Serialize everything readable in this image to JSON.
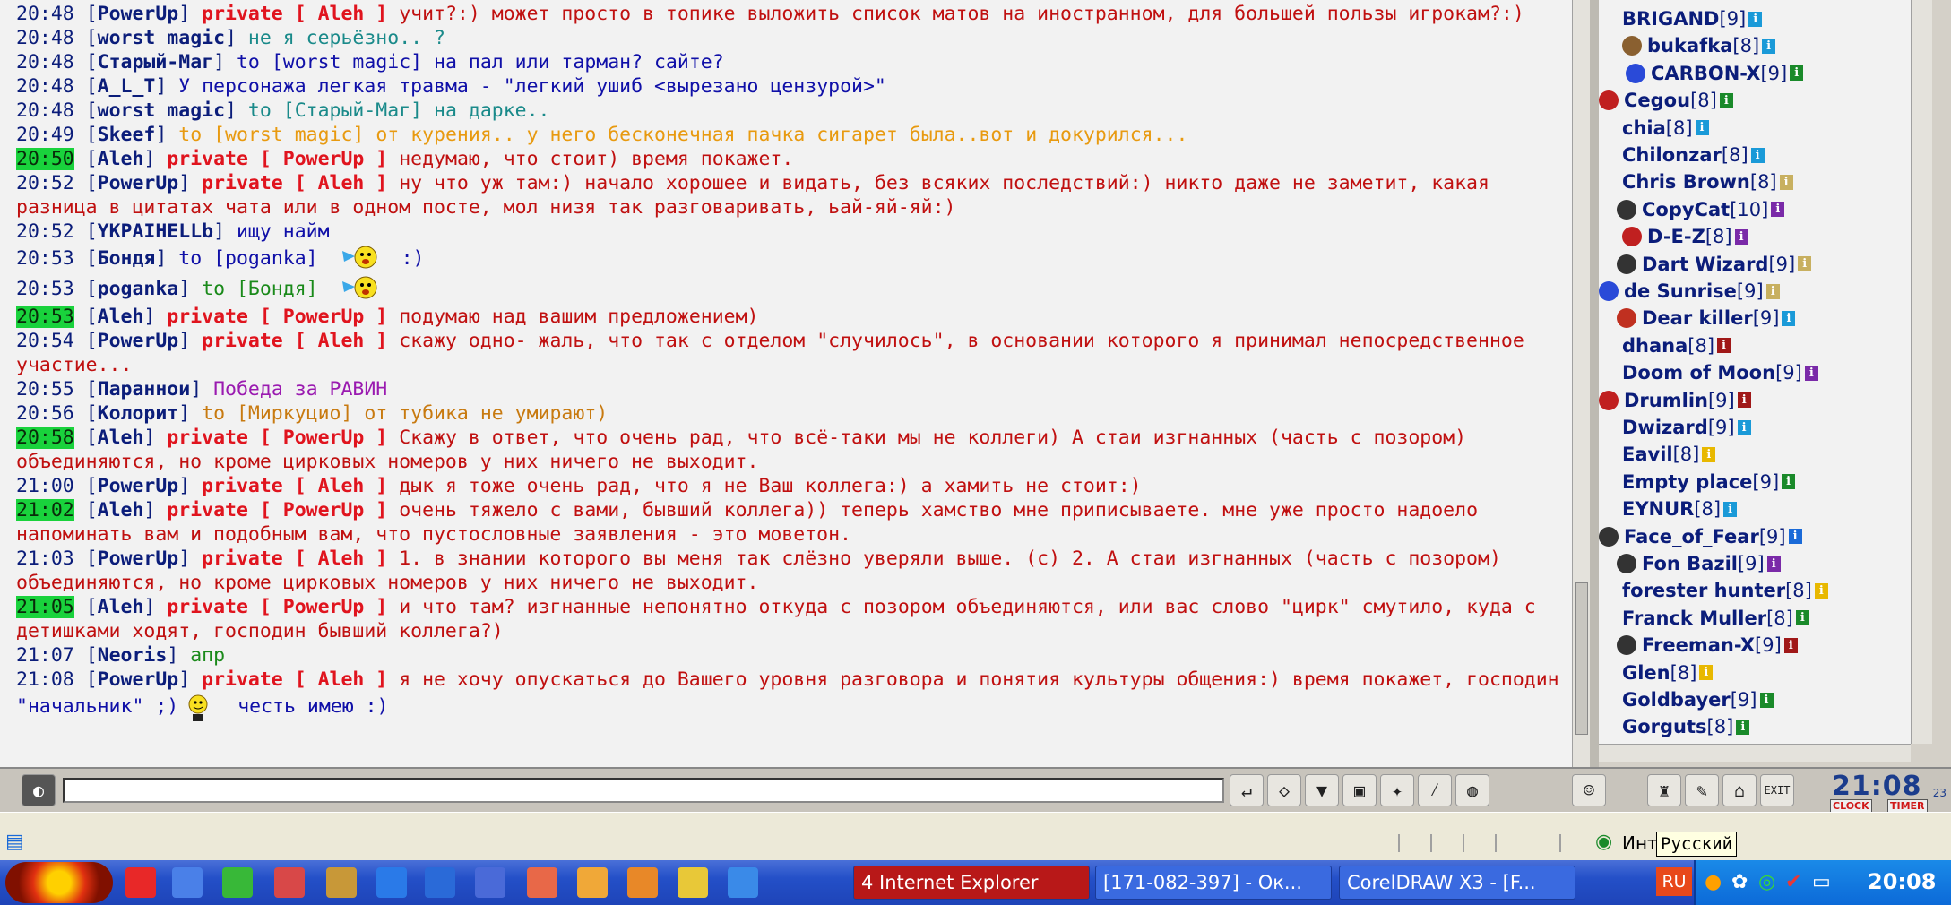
{
  "chat": {
    "lines": [
      {
        "time": "20:48",
        "nick": "PowerUp",
        "private": "private [ Aleh ]",
        "msg": "учит?:) может просто в топике выложить список матов на иностранном, для большей пользы игрокам?:)"
      },
      {
        "time": "20:48",
        "nick": "worst magic",
        "msg": "не я серьёзно.. ?"
      },
      {
        "time": "20:48",
        "nick": "Старый-Маг",
        "to": "to [worst magic]",
        "msg": "на пал или тарман? сайте?"
      },
      {
        "time": "20:48",
        "nick": "A_L_T",
        "msg": "У персонажа легкая травма - \"легкий ушиб <вырезано цензурой>\""
      },
      {
        "time": "20:48",
        "nick": "worst magic",
        "to": "to [Старый-Маг]",
        "msg": "на дарке.."
      },
      {
        "time": "20:49",
        "nick": "Skeef",
        "to": "to [worst magic]",
        "msg": "от курения.. у него бесконечная пачка сигарет была..вот и докурился..."
      },
      {
        "time": "20:50",
        "nick": "Aleh",
        "private": "private [ PowerUp ]",
        "msg": "недумаю, что стоит) время покажет."
      },
      {
        "time": "20:52",
        "nick": "PowerUp",
        "private": "private [ Aleh ]",
        "msg": "ну что уж там:) начало хорошее и видать, без всяких последствий:) никто даже не заметит, какая разница в цитатах чата или в одном посте, мол низя так разговаривать, ьай-яй-яй:)"
      },
      {
        "time": "20:52",
        "nick": "YKPAIHELLb",
        "msg": "ищу найм"
      },
      {
        "time": "20:53",
        "nick": "Бондя",
        "to": "to [poganka]",
        "msg": ":)"
      },
      {
        "time": "20:53",
        "nick": "poganka",
        "to": "to [Бондя]",
        "msg": ""
      },
      {
        "time": "20:53",
        "nick": "Aleh",
        "private": "private [ PowerUp ]",
        "msg": "подумаю над вашим предложением)"
      },
      {
        "time": "20:54",
        "nick": "PowerUp",
        "private": "private [ Aleh ]",
        "msg": "скажу одно- жаль, что так с отделом \"случилось\", в основании которого я принимал непосредственное участие..."
      },
      {
        "time": "20:55",
        "nick": "Параннои",
        "msg": "Победа за РАВИН"
      },
      {
        "time": "20:56",
        "nick": "Колорит",
        "to": "to [Миркуцио]",
        "msg": "от тубика не умирают)"
      },
      {
        "time": "20:58",
        "nick": "Aleh",
        "private": "private [ PowerUp ]",
        "msg": "Скажу в ответ, что очень рад, что всё-таки мы не коллеги) А стаи изгнанных (часть с позором) объединяются, но кроме цирковых номеров у них ничего не выходит."
      },
      {
        "time": "21:00",
        "nick": "PowerUp",
        "private": "private [ Aleh ]",
        "msg": "дык я тоже очень рад, что я не Ваш коллега:) а хамить не стоит:)"
      },
      {
        "time": "21:02",
        "nick": "Aleh",
        "private": "private [ PowerUp ]",
        "msg": "очень тяжело с вами, бывший коллега)) теперь хамство мне приписываете. мне уже просто надоело напоминать вам и подобным вам, что пустословные заявления - это моветон."
      },
      {
        "time": "21:03",
        "nick": "PowerUp",
        "private": "private [ Aleh ]",
        "msg": "1. в знании которого вы меня так слёзно уверяли выше. (с) 2. А стаи изгнанных (часть с позором) объединяются, но кроме цирковых номеров у них ничего не выходит."
      },
      {
        "time": "21:05",
        "nick": "Aleh",
        "private": "private [ PowerUp ]",
        "msg": "и что там? изгнанные непонятно откуда с позором объединяются, или вас слово \"цирк\" смутило, куда с детишками ходят, господин бывший коллега?)"
      },
      {
        "time": "21:07",
        "nick": "Neoris",
        "msg": "апр"
      },
      {
        "time": "21:08",
        "nick": "PowerUp",
        "private": "private [ Aleh ]",
        "msg": "я не хочу опускаться до Вашего уровня разговора и понятия культуры общения:) время покажет, господин"
      },
      {
        "cont": "\"начальник\" ;)",
        "msg2": "честь имею :)"
      }
    ]
  },
  "users": [
    {
      "name": "BRIGAND",
      "level": "[9]",
      "info": "#1a9ad8"
    },
    {
      "name": "bukafka",
      "level": "[8]",
      "info": "#1a9ad8"
    },
    {
      "name": "CARBON-X",
      "level": "[9]",
      "info": "#1a8a2a"
    },
    {
      "name": "Cegou",
      "level": "[8]",
      "info": "#1a8a2a"
    },
    {
      "name": "chia",
      "level": "[8]",
      "info": "#1a9ad8"
    },
    {
      "name": "Chilonzar",
      "level": "[8]",
      "info": "#1a9ad8"
    },
    {
      "name": "Chris Brown",
      "level": "[8]",
      "info": "#c8b060"
    },
    {
      "name": "CopyCat",
      "level": "[10]",
      "info": "#7a2aa8"
    },
    {
      "name": "D-E-Z",
      "level": "[8]",
      "info": "#7a2aa8"
    },
    {
      "name": "Dart Wizard",
      "level": "[9]",
      "info": "#c8b060"
    },
    {
      "name": "de Sunrise",
      "level": "[9]",
      "info": "#c8b060"
    },
    {
      "name": "Dear killer",
      "level": "[9]",
      "info": "#1a9ad8"
    },
    {
      "name": "dhana",
      "level": "[8]",
      "info": "#a01818"
    },
    {
      "name": "Doom of Moon",
      "level": "[9]",
      "info": "#7a2aa8"
    },
    {
      "name": "Drumlin",
      "level": "[9]",
      "info": "#a01818"
    },
    {
      "name": "Dwizard",
      "level": "[9]",
      "info": "#1a9ad8"
    },
    {
      "name": "Eavil",
      "level": "[8]",
      "info": "#e8b800"
    },
    {
      "name": "Empty place",
      "level": "[9]",
      "info": "#1a8a2a"
    },
    {
      "name": "EYNUR",
      "level": "[8]",
      "info": "#1a9ad8"
    },
    {
      "name": "Face_of_Fear",
      "level": "[9]",
      "info": "#1a6ad8"
    },
    {
      "name": "Fon Bazil",
      "level": "[9]",
      "info": "#7a2aa8"
    },
    {
      "name": "forester hunter",
      "level": "[8]",
      "info": "#e8b800"
    },
    {
      "name": "Franck Muller",
      "level": "[8]",
      "info": "#1a8a2a"
    },
    {
      "name": "Freeman-X",
      "level": "[9]",
      "info": "#a01818"
    },
    {
      "name": "Glen",
      "level": "[8]",
      "info": "#e8b800"
    },
    {
      "name": "Goldbayer",
      "level": "[9]",
      "info": "#1a8a2a"
    },
    {
      "name": "Gorguts",
      "level": "[8]",
      "info": "#1a8a2a"
    }
  ],
  "clock": {
    "time": "21:08",
    "seconds": "23",
    "clock_label": "CLOCK",
    "timer_label": "TIMER"
  },
  "status": {
    "lang_tooltip": "Русский",
    "zone_text": "Инт"
  },
  "taskbar": {
    "tasks": [
      {
        "label": "4 Internet Explorer"
      },
      {
        "label": "[171-082-397] - Ок..."
      },
      {
        "label": "CorelDRAW X3 - [F..."
      }
    ],
    "lang": "RU",
    "time": "20:08"
  }
}
